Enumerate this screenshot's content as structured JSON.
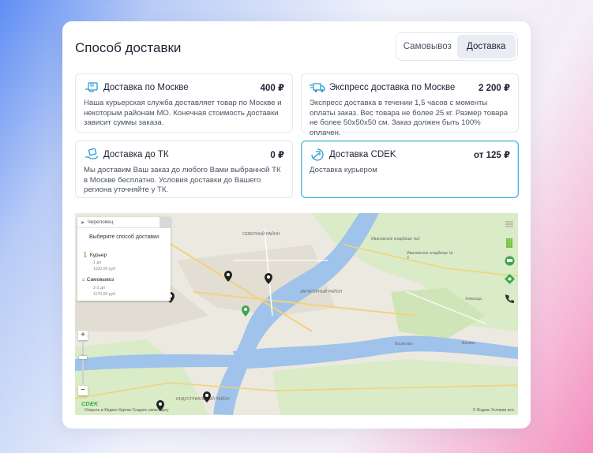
{
  "header": {
    "title": "Способ доставки"
  },
  "tabs": [
    {
      "label": "Самовывоз",
      "active": false
    },
    {
      "label": "Доставка",
      "active": true
    }
  ],
  "options": [
    {
      "name": "Доставка по Москве",
      "price": "400 ₽",
      "icon": "courier-box-icon",
      "desc": "Наша курьерская служба доставляет товар по Москве и некоторым районам МО. Конечная стоимость доставки зависит суммы заказа."
    },
    {
      "name": "Экспресс доставка по Москве",
      "price": "2 200 ₽",
      "icon": "express-truck-icon",
      "desc": "Экспресс доставка в течении 1,5 часов с моменты оплаты заказ. Вес товара не более 25 кг. Размер товара не более 50x50x50 см. Заказ должен быть 100% оплачен."
    },
    {
      "name": "Доставка до ТК",
      "price": "0 ₽",
      "icon": "parcel-hand-icon",
      "desc": "Мы доставим Ваш заказ до любого Вами выбранной ТК в Москве бесплатно. Условия доставки до Вашего региона уточняйте у ТК."
    },
    {
      "name": "Доставка CDEK",
      "price": "от 125 ₽",
      "icon": "cdek-icon",
      "selected": true,
      "desc": "Доставка курьером"
    }
  ],
  "map": {
    "city": "Череповец",
    "panel_title": "Выберите способ доставки",
    "methods": [
      {
        "label": "Курьер",
        "days": "1 дн",
        "cost": "1100,00 руб"
      },
      {
        "label": "Самовывоз",
        "days": "2-3 дн",
        "cost": "1170,00 руб"
      }
    ],
    "labels": {
      "north": "СЕВЕРНЫЙ РАЙОН",
      "zaryagorny": "ЗАРЯГОРНЫЙ РАЙОН",
      "borisovo": "Борисово",
      "vachevo": "Вачево",
      "khemalda": "Хемалда",
      "industrial": "ИНДУСТРИАЛЬНЫЙ РАЙОН",
      "cemetery1": "Ивановское кладбище №2",
      "cemetery2": "Ивановское кладбище № 3"
    },
    "logo": "CDEK",
    "attribution": "Открыть в Яндекс Картах   Создать свою карту",
    "copyright": "© Яндекс  Условия исп.",
    "colors": {
      "water": "#8fb9e6",
      "green": "#cfe8b4",
      "accent": "#4bb6d9"
    }
  }
}
